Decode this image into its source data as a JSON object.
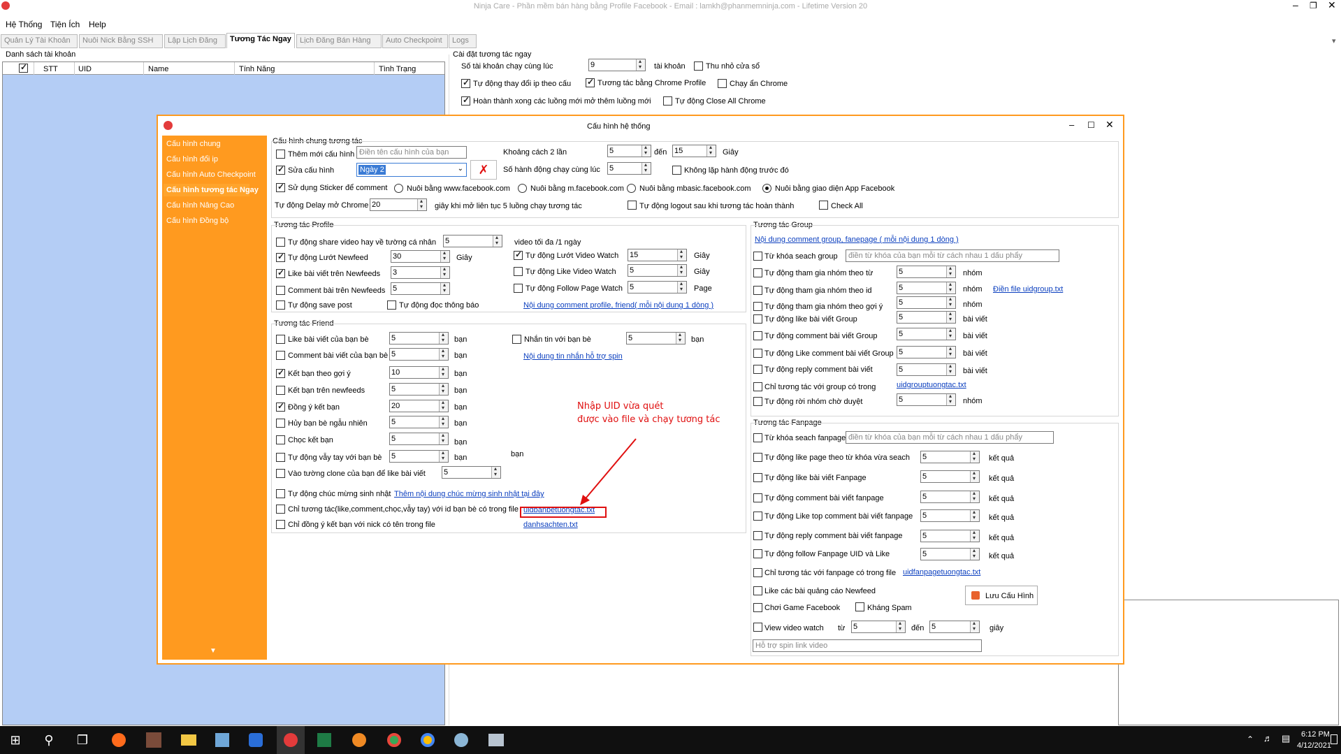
{
  "app": {
    "title": "Ninja Care - Phần mềm bán hàng bằng Profile Facebook - Email : lamkh@phanmemninja.com - Lifetime Version 20",
    "menu": [
      "Hệ Thống",
      "Tiện Ích",
      "Help"
    ],
    "tabs": [
      "Quản Lý Tài Khoản",
      "Nuôi Nick Bằng SSH",
      "Lập Lịch Đăng",
      "Tương Tác Ngay",
      "Lịch Đăng Bán Hàng",
      "Auto Checkpoint",
      "Logs"
    ],
    "account_list_label": "Danh sách tài khoản",
    "columns": [
      "STT",
      "UID",
      "Name",
      "Tính Năng",
      "Tình Trạng"
    ],
    "settings_title": "Cài đặt tương tác ngay",
    "accounts_concurrent_label": "Số tài khoản chạy cùng lúc",
    "accounts_concurrent_value": "9",
    "accounts_unit": "tài khoản",
    "minimize_window": "Thu nhỏ cửa sổ",
    "auto_change_ip": "Tự động thay đổi ip theo cấu",
    "interact_chrome_profile": "Tương tác bằng Chrome Profile",
    "hide_chrome": "Chạy ẩn Chrome",
    "finish_new_thread": "Hoàn thành xong các luồng mới mở thêm luồng mới",
    "auto_close_chrome": "Tự động Close All Chrome"
  },
  "dialog": {
    "title": "Cấu hình hệ thống",
    "sidebar": [
      "Cấu hình chung",
      "Cấu hình đổi ip",
      "Cấu hình Auto Checkpoint",
      "Cấu hình tương tác Ngay",
      "Cấu hình Nâng Cao",
      "Cấu hình Đồng bộ"
    ],
    "general": {
      "title": "Cấu hình chung tương tác",
      "add_config": "Thêm mới cấu hình",
      "config_name_placeholder": "Điền tên cấu hình của bạn",
      "edit_config": "Sửa cấu hình",
      "config_selected": "Ngày 2",
      "gap_label": "Khoảng cách 2 lần",
      "gap_from": "5",
      "to": "đến",
      "gap_to": "15",
      "seconds": "Giây",
      "actions_label": "Số hành động chạy cùng lúc",
      "actions_value": "5",
      "no_repeat": "Không lặp hành động trước đó",
      "use_sticker": "Sử dụng Sticker để comment",
      "radio_www": "Nuôi bằng www.facebook.com",
      "radio_m": "Nuôi bằng m.facebook.com",
      "radio_mbasic": "Nuôi bằng mbasic.facebook.com",
      "radio_app": "Nuôi bằng giao diện App Facebook",
      "delay_label": "Tự động Delay mở Chrome",
      "delay_value": "20",
      "delay_suffix": "giây khi mở liên tục 5 luồng chạy tương tác",
      "auto_logout": "Tự động logout sau khi tương tác hoàn thành",
      "check_all": "Check All"
    },
    "profile": {
      "title": "Tương tác Profile",
      "share_video": "Tự động share video hay về tường cá nhân",
      "share_video_value": "5",
      "share_video_suffix": "video tối đa /1 ngày",
      "scroll_newsfeed": "Tự động Lướt Newfeed",
      "scroll_value": "30",
      "sec": "Giây",
      "scroll_video_watch": "Tự động Lướt Video Watch",
      "scroll_video_value": "15",
      "like_newsfeed": "Like bài viết trên Newfeeds",
      "like_newsfeed_value": "3",
      "like_video_watch": "Tự động Like Video Watch",
      "like_video_value": "5",
      "comment_newsfeed": "Comment bài trên Newfeeds",
      "comment_value": "5",
      "follow_page_watch": "Tự động Follow Page Watch",
      "follow_value": "5",
      "page": "Page",
      "save_post": "Tự động save post",
      "read_notifications": "Tự động đọc thông báo",
      "comment_content_link": "Nội dung comment profile, friend( mỗi nội dung 1 dòng )"
    },
    "friend": {
      "title": "Tương tác Friend",
      "unit": "bạn",
      "like_friend": "Like bài viết của bạn bè",
      "like_friend_value": "5",
      "message_friend": "Nhắn tin với bạn bè",
      "message_value": "5",
      "comment_friend": "Comment bài viết của bạn bè",
      "comment_friend_value": "5",
      "message_content_link": "Nội dung tin nhắn hỗ trợ spin",
      "add_suggested": "Kết bạn theo gợi ý",
      "add_suggested_value": "10",
      "add_newsfeed": "Kết bạn trên newfeeds",
      "add_newsfeed_value": "5",
      "accept_friend": "Đồng ý kết bạn",
      "accept_value": "20",
      "unfriend_random": "Hủy bạn bè ngẫu nhiên",
      "unfriend_value": "5",
      "poke": "Chọc kết bạn",
      "poke_value": "5",
      "wave": "Tự động vẫy tay với bạn bè",
      "wave_value": "5",
      "clone_wall": "Vào tường clone của bạn để like bài viết",
      "clone_value": "5",
      "birthday": "Tự động chúc mừng sinh nhật",
      "birthday_link": "Thêm nội dung chúc mừng sinh nhật tại đây",
      "only_uid_file": "Chỉ tương tác(like,comment,chọc,vẫy tay) với id bạn bè có trong file",
      "uid_file_link": "uidbanbetuongtac.txt",
      "only_accept_list": "Chỉ đồng ý kết bạn với nick có tên trong file",
      "accept_list_link": "danhsachten.txt"
    },
    "annotation": [
      "Nhập UID vừa quét",
      "được vào file và chạy tương tác"
    ],
    "group": {
      "title": "Tương tác Group",
      "comment_content_link": "Nội dung comment group, fanepage ( mỗi nội dung 1 dòng )",
      "keyword_search": "Từ khóa seach group",
      "keyword_placeholder": "điền từ khóa của bạn mỗi từ cách nhau 1 dấu phẩy",
      "join_by_keyword": "Tự động tham gia nhóm theo từ",
      "join_by_id": "Tự động tham gia nhóm theo id",
      "join_by_suggestion": "Tự động tham gia nhóm theo gợi ý",
      "like_post": "Tự động like bài viết Group",
      "comment_post": "Tự động comment bài viết Group",
      "like_comment": "Tự động Like comment bài viết Group",
      "reply_comment": "Tự động reply comment bài viết",
      "only_group_file": "Chỉ tương tác với group có trong",
      "leave_pending": "Tự động rời nhóm chờ duyệt",
      "nhom": "nhóm",
      "bai_viet": "bài viết",
      "fill_uid_link": "Điền file uidgroup.txt",
      "group_file_link": "uidgrouptuongtac.txt",
      "values": [
        "5",
        "5",
        "5",
        "5",
        "5",
        "5",
        "5",
        "5"
      ]
    },
    "fanpage": {
      "title": "Tương tác Fanpage",
      "keyword_search": "Từ khóa seach fanpage",
      "keyword_placeholder": "điền từ khóa của bạn mỗi từ cách nhau 1 dấu phẩy",
      "like_by_keyword": "Tự động like page theo từ khóa vừa seach",
      "like_post": "Tự động like bài viết Fanpage",
      "comment_post": "Tự động comment bài viết fanpage",
      "like_top_comment": "Tự động Like top comment bài viết fanpage",
      "reply_comment": "Tự động reply comment bài viết fanpage",
      "follow_uid": "Tự động follow Fanpage UID và Like",
      "only_fanpage_file": "Chỉ tương tác với fanpage có trong file",
      "fanpage_file_link": "uidfanpagetuongtac.txt",
      "like_ads": "Like các bài quảng cáo Newfeed",
      "play_game": "Chơi Game Facebook",
      "anti_spam": "Kháng Spam",
      "view_video": "View video watch",
      "from": "từ",
      "to": "đến",
      "view_from": "5",
      "view_to": "5",
      "giay": "giây",
      "result": "kết quả",
      "values": [
        "5",
        "5",
        "5",
        "5",
        "5",
        "5"
      ],
      "spin_placeholder": "Hỗ trợ spin link video",
      "save_button": "Lưu Cấu Hình"
    }
  },
  "taskbar": {
    "time": "6:12 PM",
    "date": "4/12/2021"
  },
  "colors": {
    "accent_orange": "#ff9a1f",
    "sidebar_active": "#ffa42c",
    "grid_blue": "#b4cdf5",
    "link_blue": "#0b3fbf",
    "annotation_red": "#e01010"
  }
}
